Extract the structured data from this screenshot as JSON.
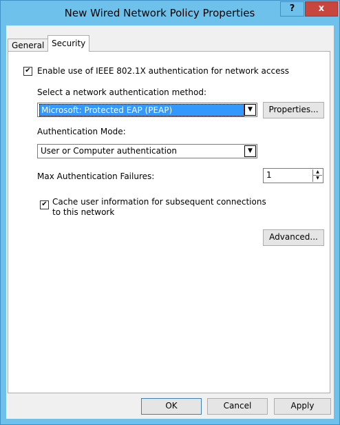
{
  "window": {
    "title": "New Wired Network Policy Properties",
    "help_label": "?",
    "close_label": "x"
  },
  "tabs": [
    {
      "label": "General"
    },
    {
      "label": "Security"
    }
  ],
  "security": {
    "enable_8021x": {
      "label": "Enable use of IEEE 802.1X authentication for network access",
      "checked": true
    },
    "auth_method_label": "Select a network authentication method:",
    "auth_method_value": "Microsoft: Protected EAP (PEAP)",
    "properties_button": "Properties...",
    "auth_mode_label": "Authentication Mode:",
    "auth_mode_value": "User or Computer authentication",
    "max_failures_label": "Max Authentication Failures:",
    "max_failures_value": "1",
    "cache_user_info": {
      "label_line1": "Cache user information for subsequent connections",
      "label_line2": "to this network",
      "checked": true
    },
    "advanced_button": "Advanced..."
  },
  "footer": {
    "ok": "OK",
    "cancel": "Cancel",
    "apply": "Apply"
  },
  "icons": {
    "checkmark": "✔",
    "dropdown": "▼",
    "spin_up": "▲",
    "spin_down": "▼"
  },
  "colors": {
    "title_bar": "#6ec1ea",
    "close_button": "#c7463d",
    "selection": "#3399ff"
  }
}
